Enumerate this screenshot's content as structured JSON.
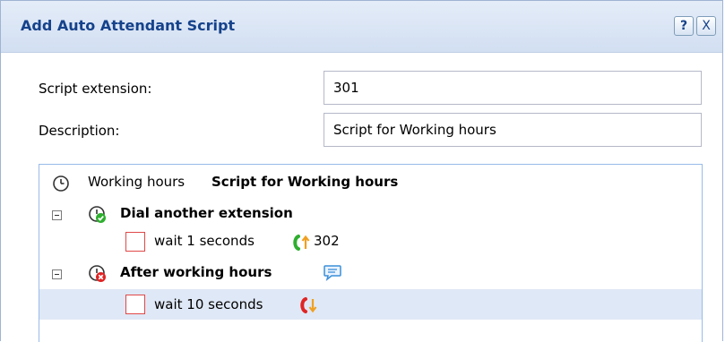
{
  "window": {
    "title": "Add Auto Attendant Script",
    "help_label": "?",
    "close_label": "X"
  },
  "form": {
    "extension_label": "Script extension:",
    "extension_value": "301",
    "description_label": "Description:",
    "description_value": "Script for Working hours"
  },
  "tree": {
    "root": {
      "prefix": "Working hours",
      "name": "Script for Working hours",
      "icon": "clock-icon"
    },
    "nodes": [
      {
        "label": "Dial another extension",
        "icon": "clock-green-check-icon",
        "children": [
          {
            "text": "wait 1 seconds",
            "target": "302",
            "icon": "phone-transfer-out-icon"
          }
        ]
      },
      {
        "label": "After working hours",
        "icon": "clock-red-x-icon",
        "extra_icon": "speech-bubble-icon",
        "children": [
          {
            "text": "wait 10 seconds",
            "target": "",
            "icon": "phone-hangup-icon"
          }
        ]
      }
    ]
  },
  "colors": {
    "title_text": "#15428b",
    "selected_row": "#dfe8f6",
    "checkbox_border": "#e04848",
    "transfer_green": "#2fae2f",
    "transfer_arrow": "#f0a020",
    "hangup_red": "#e02424"
  }
}
